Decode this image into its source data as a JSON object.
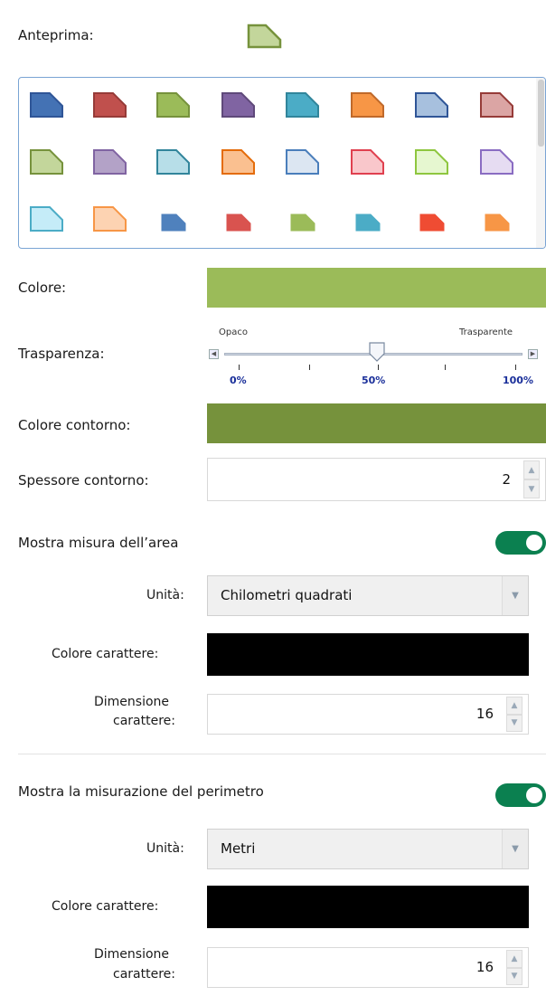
{
  "preview": {
    "label": "Anteprima:",
    "icon": "polygon-preview-icon"
  },
  "gallery": {
    "rows": [
      [
        {
          "fill": "#4472b4",
          "stroke": "#2f5597"
        },
        {
          "fill": "#c0504d",
          "stroke": "#963b38"
        },
        {
          "fill": "#9bbb59",
          "stroke": "#76923c"
        },
        {
          "fill": "#8064a2",
          "stroke": "#5f497a"
        },
        {
          "fill": "#4bacc6",
          "stroke": "#31859b"
        },
        {
          "fill": "#f79646",
          "stroke": "#c0692a"
        },
        {
          "fill": "#a7c0de",
          "stroke": "#2f5597"
        },
        {
          "fill": "#dba5a4",
          "stroke": "#963b38"
        }
      ],
      [
        {
          "fill": "#c3d69b",
          "stroke": "#76923c"
        },
        {
          "fill": "#b3a2c7",
          "stroke": "#8064a2"
        },
        {
          "fill": "#b7dee8",
          "stroke": "#31859b"
        },
        {
          "fill": "#fac090",
          "stroke": "#e46c0a"
        },
        {
          "fill": "#dce6f2",
          "stroke": "#4a7ebb"
        },
        {
          "fill": "#f9c7cb",
          "stroke": "#e0404f"
        },
        {
          "fill": "#e6f7d0",
          "stroke": "#8ec63f"
        },
        {
          "fill": "#e6dcf2",
          "stroke": "#8a6cc2"
        }
      ],
      [
        {
          "fill": "#c5ecf8",
          "stroke": "#4bacc6"
        },
        {
          "fill": "#fdd3b2",
          "stroke": "#f79646"
        },
        {
          "fill": "#4f81bd",
          "stroke": "#4f81bd"
        },
        {
          "fill": "#d9534f",
          "stroke": "#d9534f"
        },
        {
          "fill": "#9bbb59",
          "stroke": "#9bbb59"
        },
        {
          "fill": "#4bacc6",
          "stroke": "#4bacc6"
        },
        {
          "fill": "#ef4c33",
          "stroke": "#ef4c33"
        },
        {
          "fill": "#f79646",
          "stroke": "#f79646"
        }
      ]
    ]
  },
  "color": {
    "label": "Colore:",
    "value": "#9bbb59"
  },
  "transparency": {
    "label": "Trasparenza:",
    "min_caption": "Opaco",
    "max_caption": "Trasparente",
    "ticks": [
      "0%",
      "50%",
      "100%"
    ],
    "value_percent": 50
  },
  "outline_color": {
    "label": "Colore contorno:",
    "value": "#76923c"
  },
  "outline_width": {
    "label": "Spessore contorno:",
    "value": "2"
  },
  "area": {
    "toggle_label": "Mostra misura dell’area",
    "enabled": true,
    "unit_label": "Unità:",
    "unit_value": "Chilometri quadrati",
    "font_color_label": "Colore carattere:",
    "font_color": "#000000",
    "font_size_label_1": "Dimensione",
    "font_size_label_2": "carattere:",
    "font_size": "16"
  },
  "perimeter": {
    "toggle_label": "Mostra la misurazione del perimetro",
    "enabled": true,
    "unit_label": "Unità:",
    "unit_value": "Metri",
    "font_color_label": "Colore carattere:",
    "font_color": "#000000",
    "font_size_label_1": "Dimensione",
    "font_size_label_2": "carattere:",
    "font_size": "16"
  },
  "colors": {
    "toggle_on": "#0b8050",
    "gallery_border": "#7aa4d4"
  }
}
